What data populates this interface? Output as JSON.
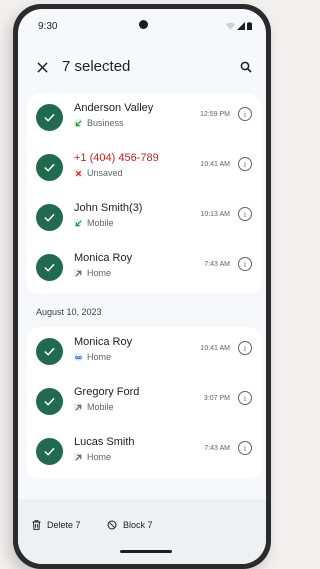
{
  "status_bar": {
    "time": "9:30"
  },
  "app_bar": {
    "title": "7 selected",
    "close_icon": "close-icon",
    "search_icon": "search-icon"
  },
  "colors": {
    "accent": "#216a4f",
    "unsaved": "#c5221f",
    "business": "#1e8e3e",
    "duo": "#1a73e8"
  },
  "calls": [
    {
      "name": "Anderson Valley",
      "type": "Business",
      "type_icon": "call-received-icon",
      "time": "12:59 PM",
      "name_color": "normal"
    },
    {
      "name": "+1 (404) 456-789",
      "type": "Unsaved",
      "type_icon": "missed-call-icon",
      "time": "10:41 AM",
      "name_color": "red"
    },
    {
      "name": "John Smith(3)",
      "type": "Mobile",
      "type_icon": "call-received-icon",
      "time": "10:13 AM",
      "name_color": "normal"
    },
    {
      "name": "Monica Roy",
      "type": "Home",
      "type_icon": "call-made-icon",
      "time": "7:43 AM",
      "name_color": "normal"
    }
  ],
  "section": {
    "date": "August 10, 2023"
  },
  "calls_older": [
    {
      "name": "Monica Roy",
      "type": "Home",
      "type_icon": "voicemail-icon",
      "time": "10:41 AM"
    },
    {
      "name": "Gregory Ford",
      "type": "Mobile",
      "type_icon": "call-made-icon",
      "time": "3:07 PM"
    },
    {
      "name": "Lucas Smith",
      "type": "Home",
      "type_icon": "call-made-icon",
      "time": "7:43 AM"
    }
  ],
  "actions": {
    "delete_label": "Delete 7",
    "block_label": "Block 7"
  }
}
